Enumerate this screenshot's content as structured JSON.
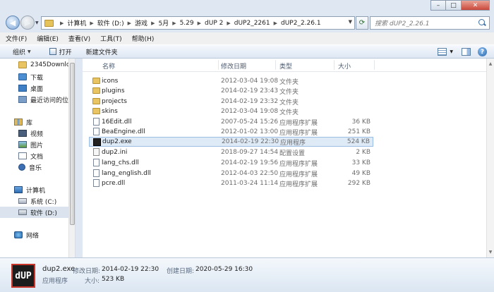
{
  "address": {
    "crumbs": [
      "计算机",
      "软件 (D:)",
      "游戏",
      "5月",
      "5.29",
      "dUP 2",
      "dUP2_2261",
      "dUP2_2.26.1"
    ]
  },
  "search": {
    "placeholder": "搜索 dUP2_2.26.1"
  },
  "menu": [
    "文件(F)",
    "编辑(E)",
    "查看(V)",
    "工具(T)",
    "帮助(H)"
  ],
  "toolbar": {
    "organize": "组织",
    "open": "打开",
    "new_folder": "新建文件夹"
  },
  "nav": {
    "items": [
      {
        "label": "2345Downloads",
        "icon": "folder-icon"
      },
      {
        "label": "下载",
        "icon": "download-icon"
      },
      {
        "label": "桌面",
        "icon": "desktop-icon"
      },
      {
        "label": "最近访问的位置",
        "icon": "recent-places-icon"
      },
      {
        "label": "库",
        "icon": "library-icon"
      },
      {
        "label": "视频",
        "icon": "video-icon"
      },
      {
        "label": "图片",
        "icon": "pictures-icon"
      },
      {
        "label": "文档",
        "icon": "documents-icon"
      },
      {
        "label": "音乐",
        "icon": "music-icon"
      },
      {
        "label": "计算机",
        "icon": "computer-icon"
      },
      {
        "label": "系统 (C:)",
        "icon": "drive-icon"
      },
      {
        "label": "软件 (D:)",
        "icon": "drive-icon"
      },
      {
        "label": "网络",
        "icon": "network-icon"
      }
    ]
  },
  "columns": {
    "name": "名称",
    "date": "修改日期",
    "type": "类型",
    "size": "大小"
  },
  "files": [
    {
      "name": "icons",
      "date": "2012-03-04 19:08",
      "type": "文件夹",
      "size": "",
      "kind": "folder"
    },
    {
      "name": "plugins",
      "date": "2014-02-19 23:43",
      "type": "文件夹",
      "size": "",
      "kind": "folder"
    },
    {
      "name": "projects",
      "date": "2014-02-19 23:32",
      "type": "文件夹",
      "size": "",
      "kind": "folder"
    },
    {
      "name": "skins",
      "date": "2012-03-04 19:08",
      "type": "文件夹",
      "size": "",
      "kind": "folder"
    },
    {
      "name": "16Edit.dll",
      "date": "2007-05-24 15:26",
      "type": "应用程序扩展",
      "size": "36 KB",
      "kind": "dll"
    },
    {
      "name": "BeaEngine.dll",
      "date": "2012-01-02 13:00",
      "type": "应用程序扩展",
      "size": "251 KB",
      "kind": "dll"
    },
    {
      "name": "dup2.exe",
      "date": "2014-02-19 22:30",
      "type": "应用程序",
      "size": "524 KB",
      "kind": "exe"
    },
    {
      "name": "dup2.ini",
      "date": "2018-09-27 14:54",
      "type": "配置设置",
      "size": "2 KB",
      "kind": "ini"
    },
    {
      "name": "lang_chs.dll",
      "date": "2014-02-19 19:56",
      "type": "应用程序扩展",
      "size": "33 KB",
      "kind": "dll"
    },
    {
      "name": "lang_english.dll",
      "date": "2012-04-03 22:50",
      "type": "应用程序扩展",
      "size": "49 KB",
      "kind": "dll"
    },
    {
      "name": "pcre.dll",
      "date": "2011-03-24 11:14",
      "type": "应用程序扩展",
      "size": "292 KB",
      "kind": "dll"
    }
  ],
  "selected_index": 6,
  "details": {
    "icon_text": "dUP",
    "name": "dup2.exe",
    "modified_label": "修改日期:",
    "modified_value": "2014-02-19 22:30",
    "created_label": "创建日期:",
    "created_value": "2020-05-29 16:30",
    "type": "应用程序",
    "size_label": "大小:",
    "size_value": "523 KB"
  }
}
